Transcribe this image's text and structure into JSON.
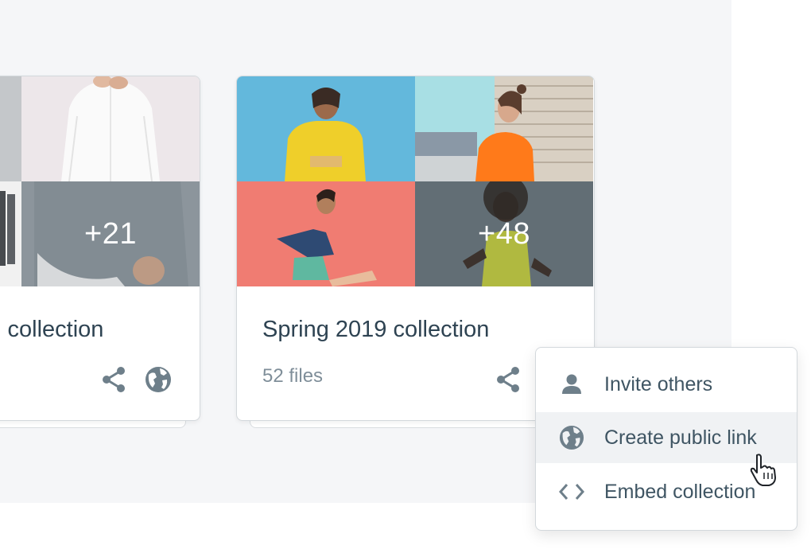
{
  "collections": [
    {
      "title": "Fall collection",
      "title_visible": "l collection",
      "more_count": "+21",
      "actions": [
        "share-icon",
        "globe-icon"
      ]
    },
    {
      "title": "Spring 2019 collection",
      "files": "52 files",
      "more_count": "+48",
      "actions": [
        "share-icon"
      ]
    }
  ],
  "share_menu": {
    "items": [
      {
        "label": "Invite others",
        "icon": "person-icon"
      },
      {
        "label": "Create public link",
        "icon": "globe-icon",
        "hovered": true
      },
      {
        "label": "Embed collection",
        "icon": "code-icon"
      }
    ]
  },
  "colors": {
    "panel_bg": "#f5f6f8",
    "icon_gray": "#6e7f8a",
    "title_text": "#2e4352",
    "hover_bg": "#f0f2f4"
  }
}
